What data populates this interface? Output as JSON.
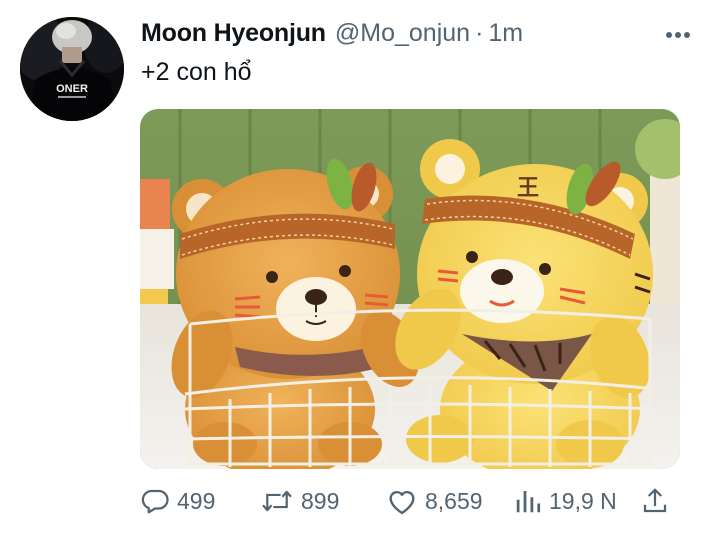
{
  "author": {
    "display_name": "Moon Hyeonjun",
    "handle": "@Mo_onjun",
    "separator": "·",
    "time": "1m",
    "avatar_jersey_text": "ONER"
  },
  "tweet": {
    "text": "+2 con hổ"
  },
  "media": {
    "headband_mark": "王"
  },
  "stats": {
    "replies": "499",
    "retweets": "899",
    "likes": "8,659",
    "views": "19,9 N"
  },
  "icons": {
    "more": "more-dots-icon",
    "reply": "reply-bubble-icon",
    "retweet": "retweet-arrows-icon",
    "like": "heart-icon",
    "views": "bar-chart-icon",
    "share": "share-upload-icon"
  },
  "colors": {
    "text_primary": "#0f1419",
    "text_secondary": "#536471",
    "background": "#ffffff"
  }
}
